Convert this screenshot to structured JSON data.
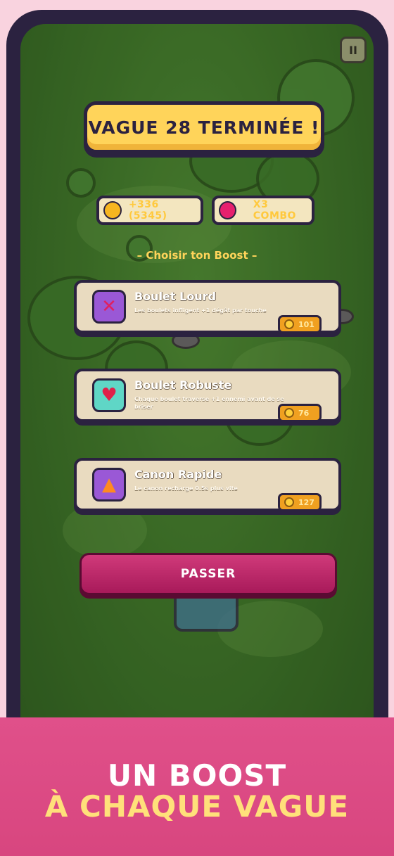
{
  "title": "VAGUE 28 TERMINÉE !",
  "pause_glyph": "II",
  "stats": {
    "coins": "+336 (5345)",
    "combo": "X3 COMBO"
  },
  "choose_label": "– Choisir ton Boost –",
  "boosts": [
    {
      "name": "Boulet Lourd",
      "desc": "Les boulets infligent +1 dégât par touche",
      "price": "101",
      "icon": "x-icon",
      "icon_color": "#9a58d6"
    },
    {
      "name": "Boulet Robuste",
      "desc": "Chaque boulet traverse +1 ennemi avant de se briser",
      "price": "76",
      "icon": "heart-icon",
      "icon_color": "#5fd6c6"
    },
    {
      "name": "Canon Rapide",
      "desc": "Le canon recharge 0.5s plus vite",
      "price": "127",
      "icon": "fire-icon",
      "icon_color": "#9a58d6"
    }
  ],
  "skip_label": "PASSER",
  "banner": {
    "line1": "UN BOOST",
    "line2": "À CHAQUE VAGUE"
  },
  "colors": {
    "accent_yellow": "#ffd45a",
    "skip_pink": "#c02a6a",
    "banner_pink": "#dc4a84",
    "frame": "#2b2240"
  }
}
